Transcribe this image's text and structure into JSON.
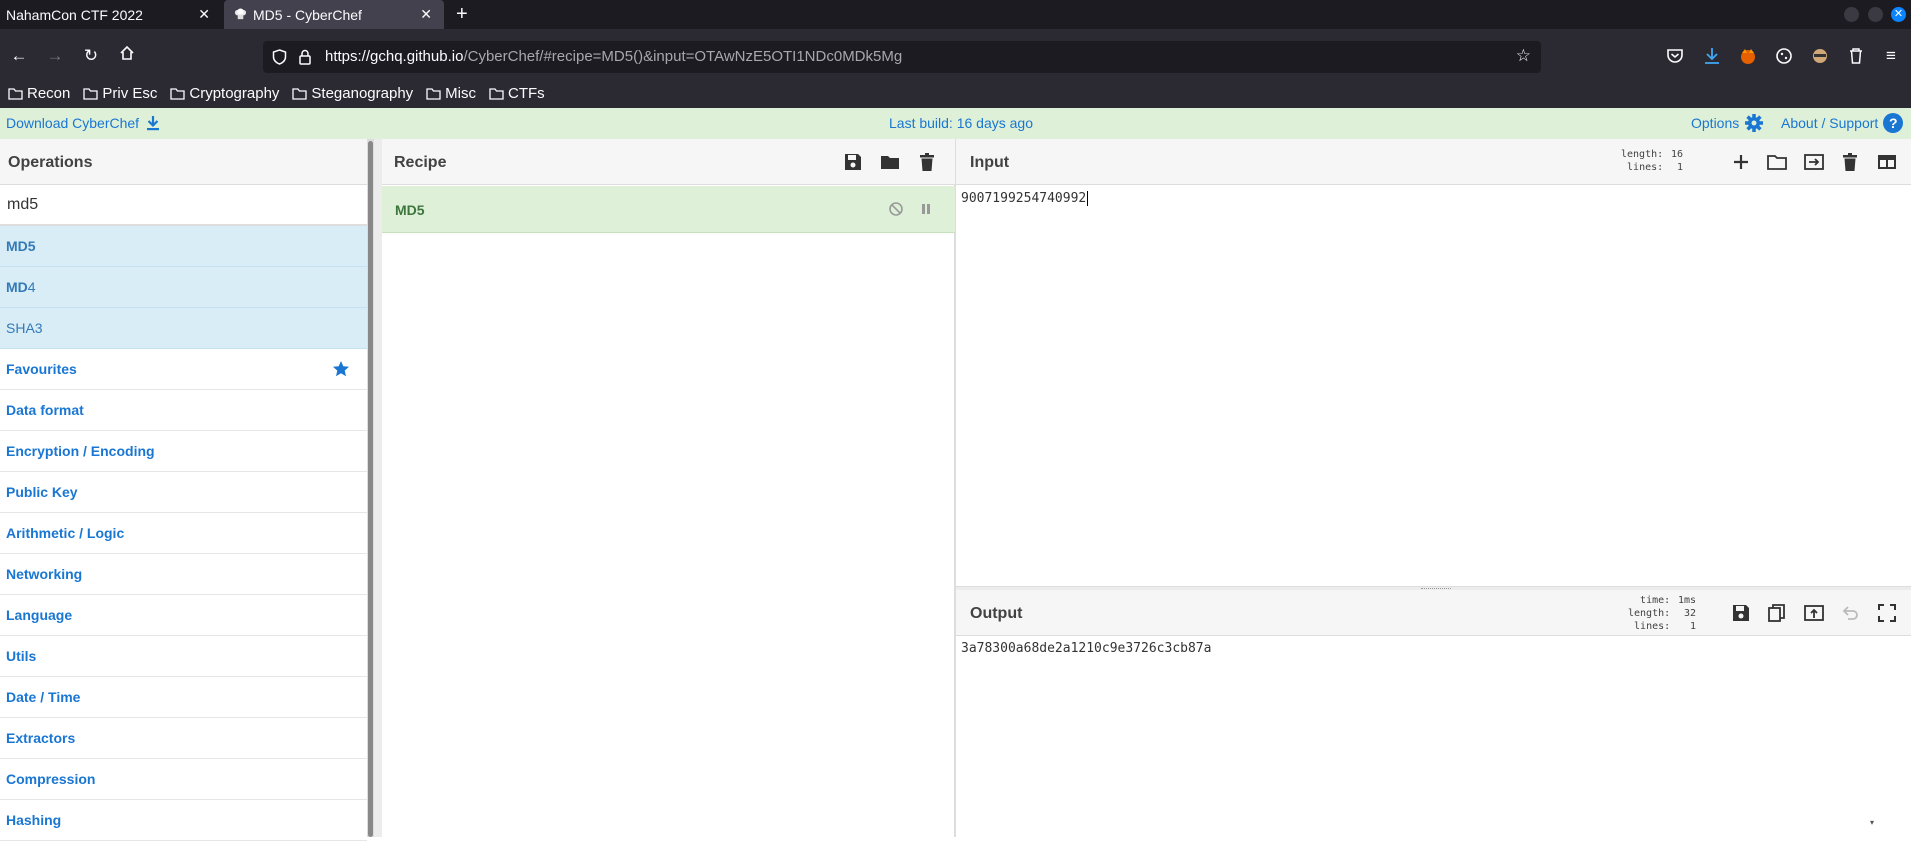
{
  "browser": {
    "tabs": [
      {
        "title": "NahamCon CTF 2022",
        "active": false
      },
      {
        "title": "MD5 - CyberChef",
        "active": true
      }
    ],
    "url_host": "https://gchq.github.io",
    "url_path": "/CyberChef/#recipe=MD5()&input=OTAwNzE5OTI1NDc0MDk5Mg",
    "bookmarks": [
      "Recon",
      "Priv Esc",
      "Cryptography",
      "Steganography",
      "Misc",
      "CTFs"
    ]
  },
  "banner": {
    "download": "Download CyberChef",
    "last_build": "Last build: 16 days ago",
    "options": "Options",
    "about": "About / Support",
    "help_glyph": "?"
  },
  "operations": {
    "title": "Operations",
    "search_value": "md5",
    "results": [
      {
        "match": "MD5",
        "rest": ""
      },
      {
        "match": "MD",
        "rest": "4"
      },
      {
        "match": "",
        "rest": "SHA3"
      }
    ],
    "categories": [
      "Favourites",
      "Data format",
      "Encryption / Encoding",
      "Public Key",
      "Arithmetic / Logic",
      "Networking",
      "Language",
      "Utils",
      "Date / Time",
      "Extractors",
      "Compression",
      "Hashing"
    ]
  },
  "recipe": {
    "title": "Recipe",
    "ops": [
      "MD5"
    ]
  },
  "input": {
    "title": "Input",
    "stats_labels": "length:\nlines:",
    "stats_values": "16\n1",
    "value": "9007199254740992"
  },
  "output": {
    "title": "Output",
    "stats_labels": "time:\nlength:\nlines:",
    "stats_values": "1ms\n32\n1",
    "value": "3a78300a68de2a1210c9e3726c3cb87a"
  },
  "colors": {
    "accent": "#1976d2",
    "banner_bg": "#dff0d8",
    "search_hit_bg": "#d9edf7",
    "recipe_op_text": "#3c763d"
  }
}
